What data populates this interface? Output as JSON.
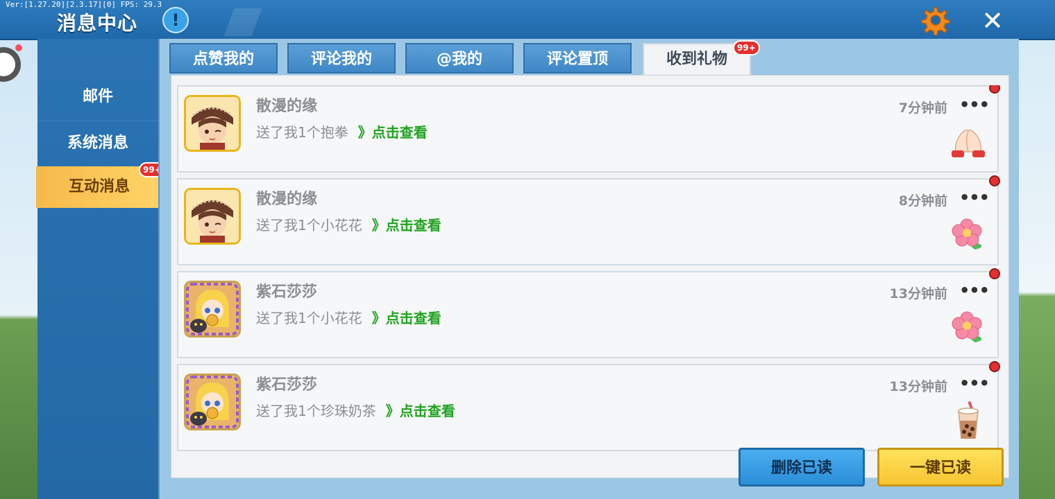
{
  "debug_text": "Ver:[1.27.20][2.3.17][0] FPS: 29.3",
  "header": {
    "title": "消息中心",
    "info_icon": "!",
    "close_icon": "✕"
  },
  "sidebar": {
    "items": [
      {
        "label": "邮件"
      },
      {
        "label": "系统消息"
      },
      {
        "label": "互动消息",
        "badge": "99+",
        "active": true
      }
    ]
  },
  "tabs": [
    {
      "label": "点赞我的"
    },
    {
      "label": "评论我的"
    },
    {
      "label": "@我的"
    },
    {
      "label": "评论置顶"
    },
    {
      "label": "收到礼物",
      "badge": "99+",
      "active": true
    }
  ],
  "messages": [
    {
      "user": "散漫的缘",
      "text": "送了我1个抱拳",
      "link": "》点击查看",
      "time": "7分钟前",
      "gift": "fist-salute-icon"
    },
    {
      "user": "散漫的缘",
      "text": "送了我1个小花花",
      "link": "》点击查看",
      "time": "8分钟前",
      "gift": "flower-icon"
    },
    {
      "user": "紫石莎莎",
      "text": "送了我1个小花花",
      "link": "》点击查看",
      "time": "13分钟前",
      "gift": "flower-icon"
    },
    {
      "user": "紫石莎莎",
      "text": "送了我1个珍珠奶茶",
      "link": "》点击查看",
      "time": "13分钟前",
      "gift": "bubble-tea-icon"
    }
  ],
  "buttons": {
    "delete_read": "删除已读",
    "mark_all_read": "一键已读"
  },
  "colors": {
    "accent": "#2469a6",
    "link": "#1fa31f",
    "badge": "#e4302f",
    "active_tab": "#f1f3f5"
  }
}
